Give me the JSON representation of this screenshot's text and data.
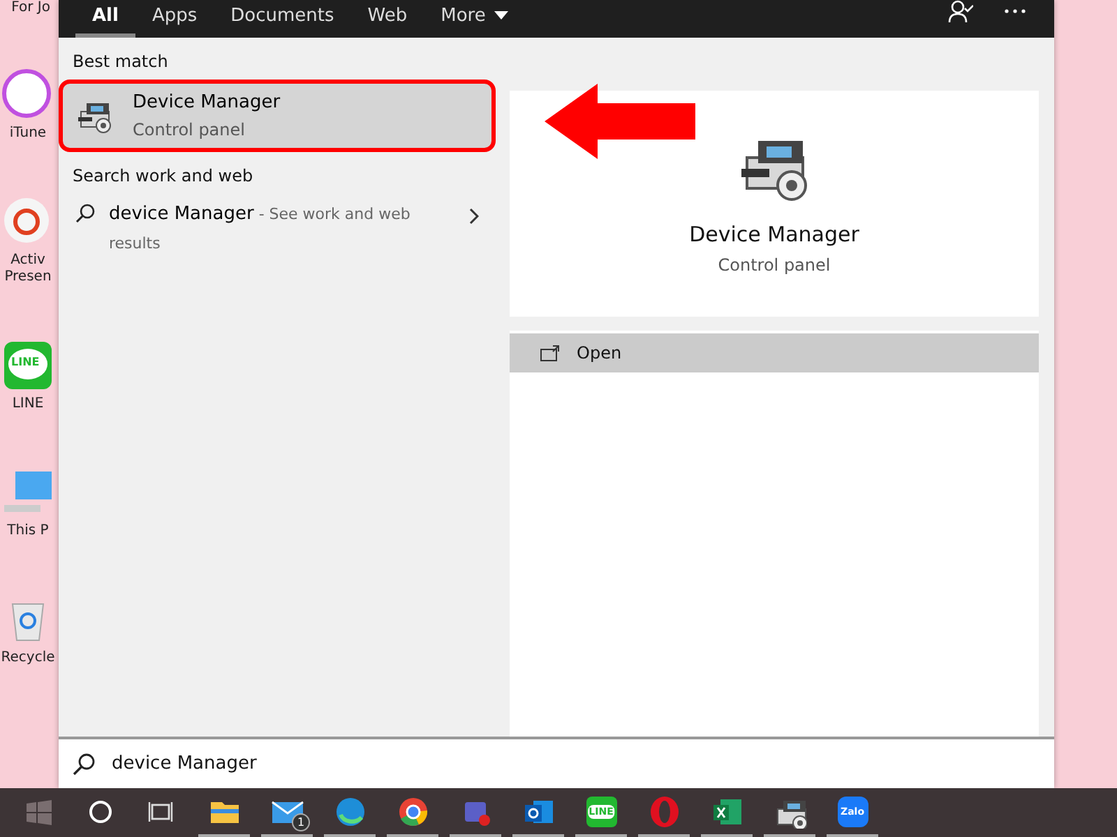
{
  "desktop": {
    "icons": [
      {
        "kind": "music",
        "label": "iTune"
      },
      {
        "kind": "activ",
        "label": "Activ Presen"
      },
      {
        "kind": "line",
        "badge": "LINE",
        "label": "LINE"
      },
      {
        "kind": "pc",
        "label": "This P"
      },
      {
        "kind": "bin",
        "label": "Recycle"
      }
    ],
    "top_label": "For Jo"
  },
  "search_window": {
    "tabs": [
      {
        "label": "All",
        "selected": true
      },
      {
        "label": "Apps",
        "selected": false
      },
      {
        "label": "Documents",
        "selected": false
      },
      {
        "label": "Web",
        "selected": false
      },
      {
        "label": "More",
        "selected": false,
        "dropdown": true
      }
    ],
    "best_match": {
      "heading": "Best match",
      "title": "Device Manager",
      "subtitle": "Control panel",
      "selected": true,
      "outlined": true
    },
    "web": {
      "heading": "Search work and web",
      "query": "device Manager",
      "hint": " - See work and web results"
    },
    "preview": {
      "title": "Device Manager",
      "subtitle": "Control panel",
      "actions": [
        {
          "label": "Open",
          "selected": true
        }
      ]
    },
    "search_box": {
      "value": "device Manager"
    }
  },
  "annotation": {
    "arrow": true
  },
  "taskbar": {
    "items": [
      {
        "kind": "start"
      },
      {
        "kind": "cortana"
      },
      {
        "kind": "taskview"
      },
      {
        "kind": "folder",
        "running": true
      },
      {
        "kind": "mail",
        "badge": "1",
        "running": true
      },
      {
        "kind": "edge",
        "running": true
      },
      {
        "kind": "chrome",
        "running": true
      },
      {
        "kind": "teams",
        "running": true
      },
      {
        "kind": "outlook",
        "running": true
      },
      {
        "kind": "line",
        "label": "LINE",
        "running": true
      },
      {
        "kind": "opera",
        "running": true
      },
      {
        "kind": "excel",
        "running": true
      },
      {
        "kind": "device",
        "running": true
      },
      {
        "kind": "zalo",
        "label": "Zalo",
        "running": true
      }
    ]
  }
}
